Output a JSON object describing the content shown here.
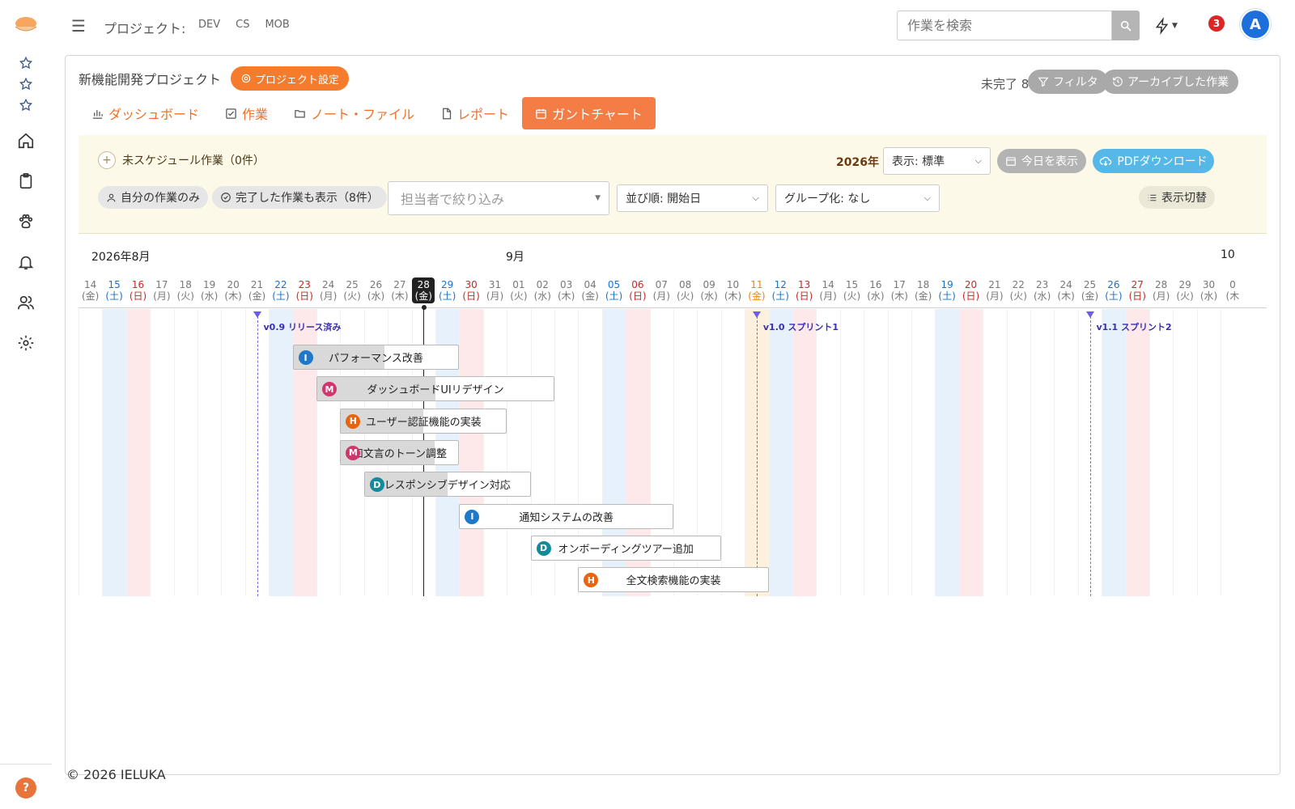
{
  "topbar": {
    "project_label": "プロジェクト:",
    "project_codes": [
      "DEV",
      "CS",
      "MOB"
    ],
    "search_placeholder": "作業を検索",
    "notification_count": "3",
    "avatar_initial": "A"
  },
  "project": {
    "title": "新機能開発プロジェクト",
    "settings_label": "プロジェクト設定",
    "incomplete_label": "未完了 8 件",
    "filter_label": "フィルタ",
    "archive_label": "アーカイブした作業"
  },
  "tabs": [
    {
      "label": "ダッシュボード",
      "icon": "bar-chart-icon"
    },
    {
      "label": "作業",
      "icon": "checkbox-icon"
    },
    {
      "label": "ノート・ファイル",
      "icon": "folder-icon"
    },
    {
      "label": "レポート",
      "icon": "document-icon"
    },
    {
      "label": "ガントチャート",
      "icon": "calendar-icon",
      "active": true
    }
  ],
  "toolbar": {
    "unscheduled_label": "未スケジュール作業（0件）",
    "year": "2026年",
    "view_select": "表示: 標準",
    "today_button": "今日を表示",
    "pdf_button": "PDFダウンロード",
    "my_tasks_chip": "自分の作業のみ",
    "show_completed_chip": "完了した作業も表示（8件）",
    "assignee_placeholder": "担当者で絞り込み",
    "sort_select": "並び順: 開始日",
    "group_select": "グループ化: なし",
    "toggle_display": "表示切替"
  },
  "gantt": {
    "months": [
      "2026年8月",
      "9月",
      "10"
    ],
    "days": [
      {
        "d": "14",
        "w": "(金)",
        "t": "wd"
      },
      {
        "d": "15",
        "w": "(土)",
        "t": "sat"
      },
      {
        "d": "16",
        "w": "(日)",
        "t": "sun"
      },
      {
        "d": "17",
        "w": "(月)",
        "t": "wd"
      },
      {
        "d": "18",
        "w": "(火)",
        "t": "wd"
      },
      {
        "d": "19",
        "w": "(水)",
        "t": "wd"
      },
      {
        "d": "20",
        "w": "(木)",
        "t": "wd"
      },
      {
        "d": "21",
        "w": "(金)",
        "t": "wd"
      },
      {
        "d": "22",
        "w": "(土)",
        "t": "sat"
      },
      {
        "d": "23",
        "w": "(日)",
        "t": "sun"
      },
      {
        "d": "24",
        "w": "(月)",
        "t": "wd"
      },
      {
        "d": "25",
        "w": "(火)",
        "t": "wd"
      },
      {
        "d": "26",
        "w": "(水)",
        "t": "wd"
      },
      {
        "d": "27",
        "w": "(木)",
        "t": "wd"
      },
      {
        "d": "28",
        "w": "(金)",
        "t": "today"
      },
      {
        "d": "29",
        "w": "(土)",
        "t": "sat"
      },
      {
        "d": "30",
        "w": "(日)",
        "t": "sun"
      },
      {
        "d": "31",
        "w": "(月)",
        "t": "wd"
      },
      {
        "d": "01",
        "w": "(火)",
        "t": "wd"
      },
      {
        "d": "02",
        "w": "(水)",
        "t": "wd"
      },
      {
        "d": "03",
        "w": "(木)",
        "t": "wd"
      },
      {
        "d": "04",
        "w": "(金)",
        "t": "wd"
      },
      {
        "d": "05",
        "w": "(土)",
        "t": "sat"
      },
      {
        "d": "06",
        "w": "(日)",
        "t": "sun"
      },
      {
        "d": "07",
        "w": "(月)",
        "t": "wd"
      },
      {
        "d": "08",
        "w": "(火)",
        "t": "wd"
      },
      {
        "d": "09",
        "w": "(水)",
        "t": "wd"
      },
      {
        "d": "10",
        "w": "(木)",
        "t": "wd"
      },
      {
        "d": "11",
        "w": "(金)",
        "t": "hol"
      },
      {
        "d": "12",
        "w": "(土)",
        "t": "sat"
      },
      {
        "d": "13",
        "w": "(日)",
        "t": "sun"
      },
      {
        "d": "14",
        "w": "(月)",
        "t": "wd"
      },
      {
        "d": "15",
        "w": "(火)",
        "t": "wd"
      },
      {
        "d": "16",
        "w": "(水)",
        "t": "wd"
      },
      {
        "d": "17",
        "w": "(木)",
        "t": "wd"
      },
      {
        "d": "18",
        "w": "(金)",
        "t": "wd"
      },
      {
        "d": "19",
        "w": "(土)",
        "t": "sat"
      },
      {
        "d": "20",
        "w": "(日)",
        "t": "sun"
      },
      {
        "d": "21",
        "w": "(月)",
        "t": "wd"
      },
      {
        "d": "22",
        "w": "(火)",
        "t": "wd"
      },
      {
        "d": "23",
        "w": "(水)",
        "t": "wd"
      },
      {
        "d": "24",
        "w": "(木)",
        "t": "wd"
      },
      {
        "d": "25",
        "w": "(金)",
        "t": "wd"
      },
      {
        "d": "26",
        "w": "(土)",
        "t": "sat"
      },
      {
        "d": "27",
        "w": "(日)",
        "t": "sun"
      },
      {
        "d": "28",
        "w": "(月)",
        "t": "wd"
      },
      {
        "d": "29",
        "w": "(火)",
        "t": "wd"
      },
      {
        "d": "30",
        "w": "(水)",
        "t": "wd"
      },
      {
        "d": "0",
        "w": "(木",
        "t": "wd"
      }
    ],
    "milestones": [
      {
        "label": "v0.9 リリース済み",
        "day": 7.5
      },
      {
        "label": "v1.0 スプリント1",
        "day": 28.5
      },
      {
        "label": "v1.1 スプリント2",
        "day": 42.5
      }
    ],
    "today_day": 14.5,
    "tasks": [
      {
        "name": "パフォーマンス改善",
        "priority": "I",
        "priority_color": "#1f78c8",
        "start": 9,
        "end": 16,
        "progress": 0.55
      },
      {
        "name": "ダッシュボードUIリデザイン",
        "priority": "M",
        "priority_color": "#d0366b",
        "start": 10,
        "end": 20,
        "progress": 0.5
      },
      {
        "name": "ユーザー認証機能の実装",
        "priority": "H",
        "priority_color": "#e86410",
        "start": 11,
        "end": 18,
        "progress": 0.5
      },
      {
        "name": "知文言のトーン調整",
        "priority": "M",
        "priority_color": "#d0366b",
        "start": 11,
        "end": 16,
        "progress": 0.8
      },
      {
        "name": "レスポンシブデザイン対応",
        "priority": "D",
        "priority_color": "#148a9a",
        "start": 12,
        "end": 19,
        "progress": 0.5
      },
      {
        "name": "通知システムの改善",
        "priority": "I",
        "priority_color": "#1f78c8",
        "start": 16,
        "end": 25,
        "progress": 0
      },
      {
        "name": "オンボーディングツアー追加",
        "priority": "D",
        "priority_color": "#148a9a",
        "start": 19,
        "end": 27,
        "progress": 0
      },
      {
        "name": "全文検索機能の実装",
        "priority": "H",
        "priority_color": "#e86410",
        "start": 21,
        "end": 29,
        "progress": 0
      }
    ]
  },
  "footer": "© 2026 IELUKA"
}
